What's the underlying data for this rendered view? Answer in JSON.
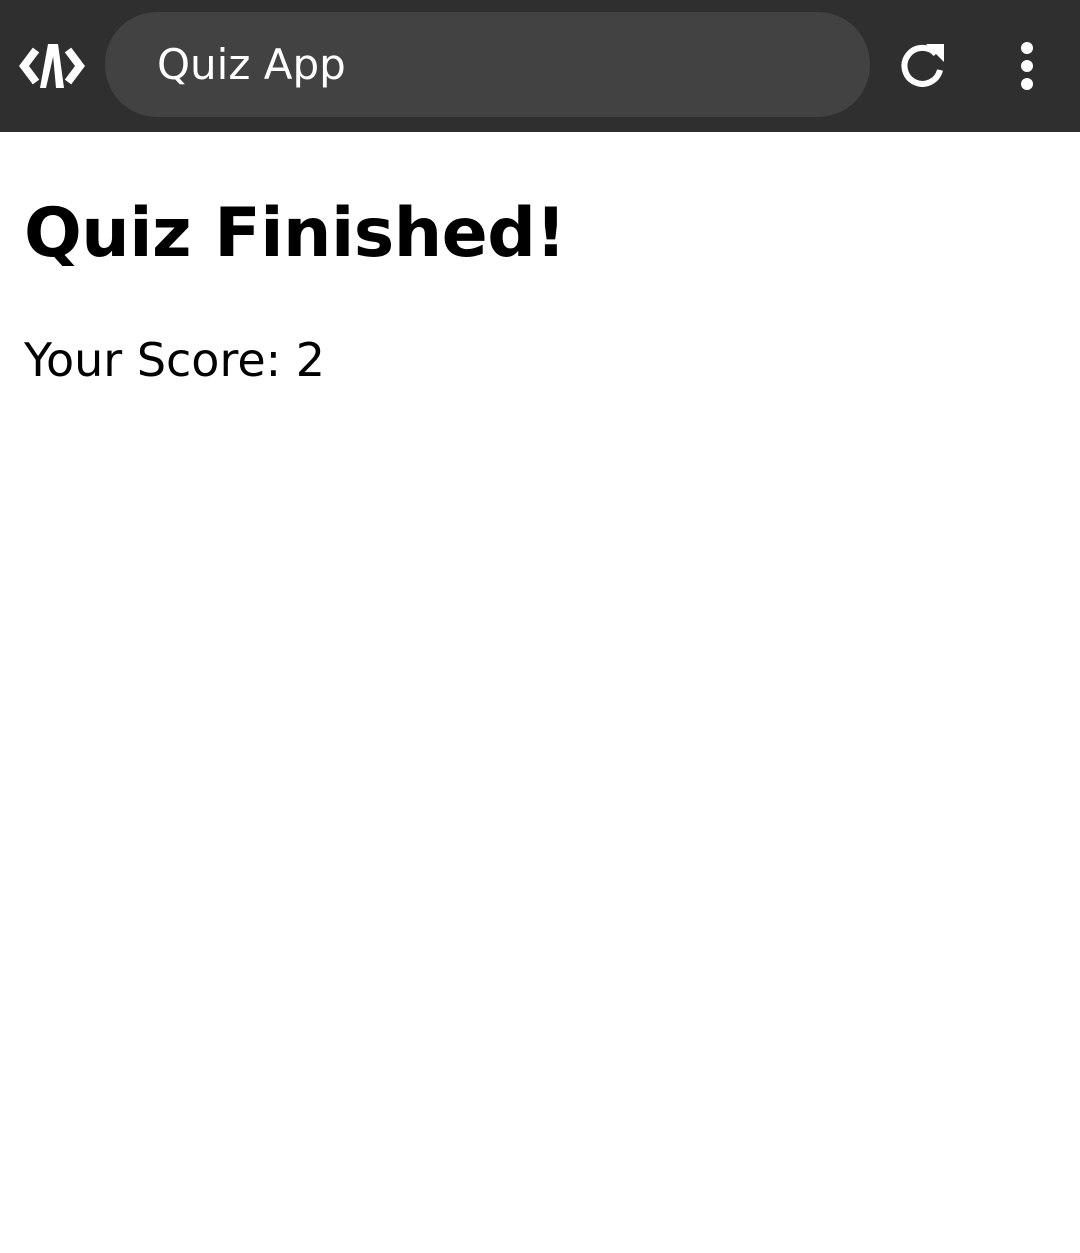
{
  "toolbar": {
    "url_text": "Quiz App",
    "logo_icon": "code-brackets-logo-icon",
    "reload_icon": "reload-icon",
    "menu_icon": "more-vert-icon",
    "colors": {
      "bar": "#2f2f2f",
      "pill": "#424242",
      "icon": "#ffffff"
    }
  },
  "main": {
    "title": "Quiz Finished!",
    "score_text": "Your Score: 2"
  }
}
